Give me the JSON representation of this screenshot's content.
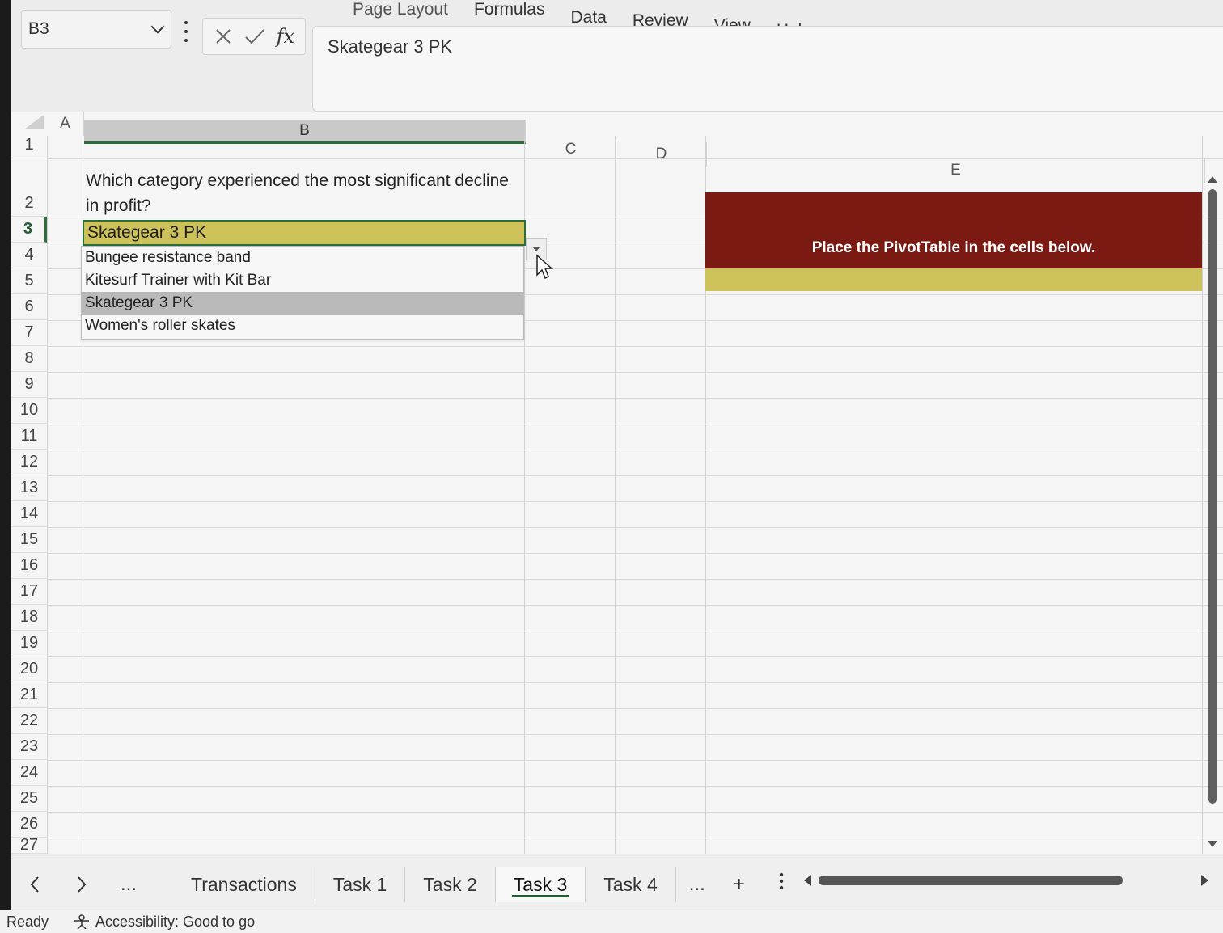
{
  "ribbon": {
    "tabs": [
      "Page Layout",
      "Formulas",
      "Data",
      "Review",
      "View",
      "Help"
    ]
  },
  "name_box": {
    "value": "B3"
  },
  "formula_bar": {
    "fx_label": "fx",
    "value": "Skategear 3 PK"
  },
  "columns": [
    "A",
    "B",
    "C",
    "D",
    "E"
  ],
  "rows": [
    "1",
    "2",
    "3",
    "4",
    "5",
    "6",
    "7",
    "8",
    "9",
    "10",
    "11",
    "12",
    "13",
    "14",
    "15",
    "16",
    "17",
    "18",
    "19",
    "20",
    "21",
    "22",
    "23",
    "24",
    "25",
    "26",
    "27"
  ],
  "sheet": {
    "question": "Which category experienced the most significant decline in profit?",
    "selected_answer": "Skategear 3 PK",
    "dropdown_options": [
      "Bungee resistance band",
      "Kitesurf Trainer with Kit Bar",
      "Skategear 3 PK",
      "Women's roller skates"
    ],
    "highlighted_option": "Skategear 3 PK",
    "pivot_banner": "Place the PivotTable in the cells below."
  },
  "sheet_tabs": {
    "tabs": [
      "Transactions",
      "Task 1",
      "Task 2",
      "Task 3",
      "Task 4"
    ],
    "active": "Task 3",
    "more": "...",
    "add": "+"
  },
  "status": {
    "ready": "Ready",
    "accessibility": "Accessibility: Good to go"
  },
  "colors": {
    "accent_green": "#2b6e3a",
    "answer_yellow": "#cdc25a",
    "banner_red": "#7a1a12"
  }
}
